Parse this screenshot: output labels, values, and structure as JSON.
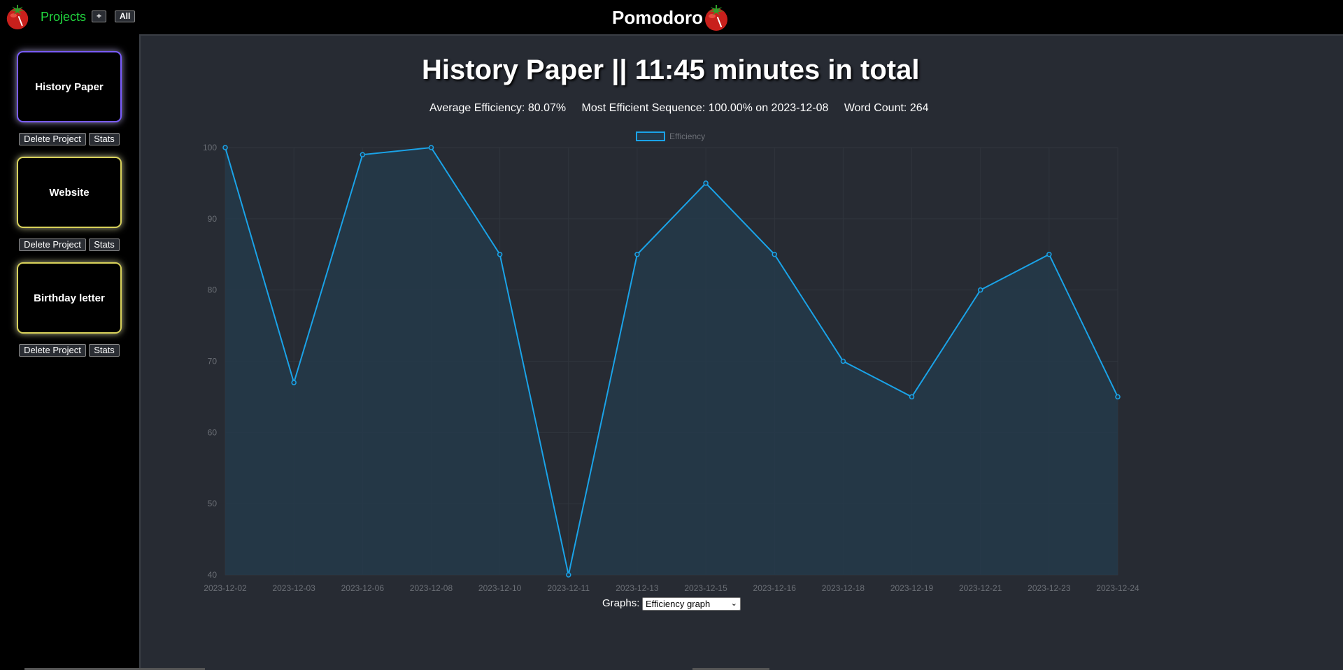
{
  "header": {
    "projects_label": "Projects",
    "add_label": "+",
    "all_label": "All",
    "app_title": "Pomodoro"
  },
  "sidebar": {
    "projects": [
      {
        "name": "History Paper",
        "delete_label": "Delete Project",
        "stats_label": "Stats"
      },
      {
        "name": "Website",
        "delete_label": "Delete Project",
        "stats_label": "Stats"
      },
      {
        "name": "Birthday letter",
        "delete_label": "Delete Project",
        "stats_label": "Stats"
      }
    ]
  },
  "main": {
    "heading": "History Paper || 11:45 minutes in total",
    "average_efficiency": "Average Efficiency: 80.07%",
    "most_efficient": "Most Efficient Sequence: 100.00% on 2023-12-08",
    "word_count": "Word Count: 264",
    "graphs_label": "Graphs:",
    "graphs_selected": "Efficiency graph"
  },
  "colors": {
    "accent_green": "#22d63f",
    "line": "#1aa3e8",
    "fill": "#24394a",
    "card_selected_border": "#7a5cff",
    "card_border": "#d9d25a"
  },
  "icons": [
    "tomato-icon",
    "chevron-down-icon"
  ],
  "chart_data": {
    "type": "line",
    "x": [
      "2023-12-02",
      "2023-12-03",
      "2023-12-06",
      "2023-12-08",
      "2023-12-10",
      "2023-12-11",
      "2023-12-13",
      "2023-12-15",
      "2023-12-16",
      "2023-12-18",
      "2023-12-19",
      "2023-12-21",
      "2023-12-23",
      "2023-12-24"
    ],
    "series": [
      {
        "name": "Efficiency",
        "values": [
          100,
          67,
          99,
          100,
          85,
          40,
          85,
          95,
          85,
          70,
          65,
          80,
          85,
          65
        ]
      }
    ],
    "ylim": [
      40,
      100
    ],
    "yticks": [
      40,
      50,
      60,
      70,
      80,
      90,
      100
    ],
    "legend": "top",
    "grid": true,
    "area_fill": true
  }
}
